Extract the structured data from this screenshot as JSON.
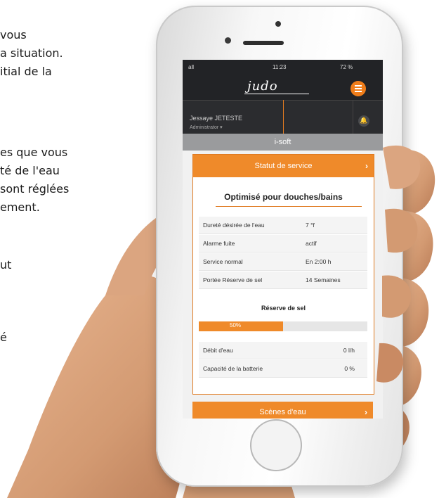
{
  "left_text": [
    "vous",
    "a situation.",
    "itial de la",
    "es que vous",
    "té de l'eau",
    "sont réglées",
    "ement.",
    "ut",
    "é"
  ],
  "status_bar": {
    "signal": "all",
    "time": "11:23",
    "battery": "72 %"
  },
  "app": {
    "logo": "judo",
    "user_name": "Jessaye JETESTE",
    "user_role": "Administrator ▾",
    "title": "i-soft"
  },
  "service_status_button": "Statut de service",
  "mode_title": "Optimisé pour douches/bains",
  "info_rows": [
    {
      "label": "Dureté désirée de l'eau",
      "value": "7 °f"
    },
    {
      "label": "Alarme fuite",
      "value": "actif"
    },
    {
      "label": "Service normal",
      "value": "En 2:00 h"
    },
    {
      "label": "Portée Réserve de sel",
      "value": "14 Semaines"
    }
  ],
  "salt_reserve": {
    "title": "Réserve de sel",
    "label": "50%",
    "fraction": 0.5
  },
  "flow_rows": [
    {
      "label": "Débit d'eau",
      "value": "0 l/h"
    },
    {
      "label": "Capacité de la batterie",
      "value": "0 %"
    }
  ],
  "water_scenes_button": "Scènes d'eau",
  "colors": {
    "accent": "#ef8a2a",
    "dark": "#222326",
    "skin": "#d9a07a"
  },
  "icons": {
    "menu": "hamburger-icon",
    "bell": "bell-icon",
    "chevron": "chevron-right-icon"
  }
}
